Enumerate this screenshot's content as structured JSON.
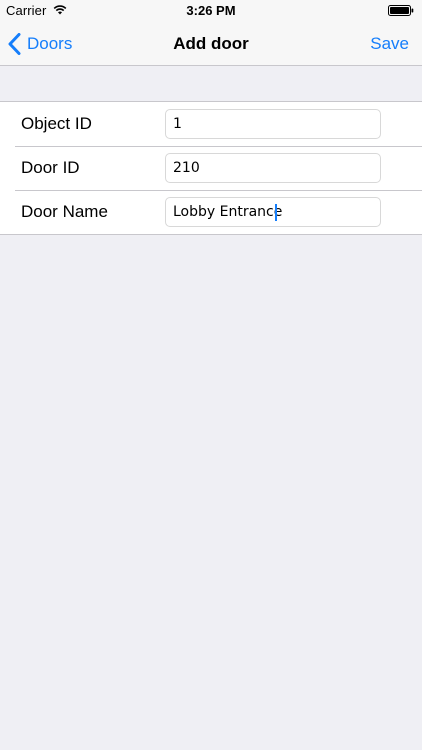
{
  "status_bar": {
    "carrier": "Carrier",
    "time": "3:26 PM",
    "wifi_icon": "wifi-icon",
    "battery_icon": "battery-icon"
  },
  "nav": {
    "back_label": "Doors",
    "back_icon": "chevron-left-icon",
    "title": "Add door",
    "save_label": "Save"
  },
  "form": {
    "rows": [
      {
        "label": "Object ID",
        "value": "1"
      },
      {
        "label": "Door ID",
        "value": "210"
      },
      {
        "label": "Door Name",
        "value": "Lobby Entrance"
      }
    ]
  },
  "colors": {
    "accent": "#157efb",
    "background": "#efeff4",
    "bar": "#f7f7f7",
    "separator": "#c8c7cc"
  }
}
